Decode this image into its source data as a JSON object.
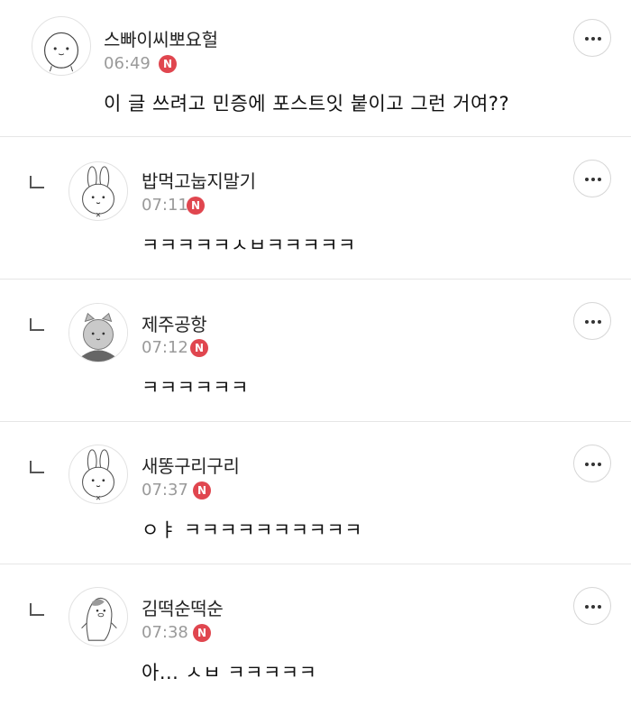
{
  "comments": [
    {
      "nickname": "스빠이씨뽀요헐",
      "time": "06:49",
      "badge": "N",
      "text": "이 글 쓰려고 민증에 포스트잇 붙이고 그런 거여??",
      "avatar": "blob-character-icon",
      "is_reply": false
    },
    {
      "nickname": "밥먹고눕지말기",
      "time": "07:11",
      "badge": "N",
      "text": "ㅋㅋㅋㅋㅋㅅㅂㅋㅋㅋㅋㅋ",
      "avatar": "bunny-character-icon",
      "is_reply": true
    },
    {
      "nickname": "제주공항",
      "time": "07:12",
      "badge": "N",
      "text": "ㅋㅋㅋㅋㅋㅋ",
      "avatar": "gray-cat-character-icon",
      "is_reply": true
    },
    {
      "nickname": "새똥구리구리",
      "time": "07:37",
      "badge": "N",
      "text": "ㅇㅑ ㅋㅋㅋㅋㅋㅋㅋㅋㅋㅋ",
      "avatar": "bunny-character-icon",
      "is_reply": true
    },
    {
      "nickname": "김떡순떡순",
      "time": "07:38",
      "badge": "N",
      "text": "아... ㅅㅂ ㅋㅋㅋㅋㅋ",
      "avatar": "penguin-character-icon",
      "is_reply": true
    }
  ]
}
